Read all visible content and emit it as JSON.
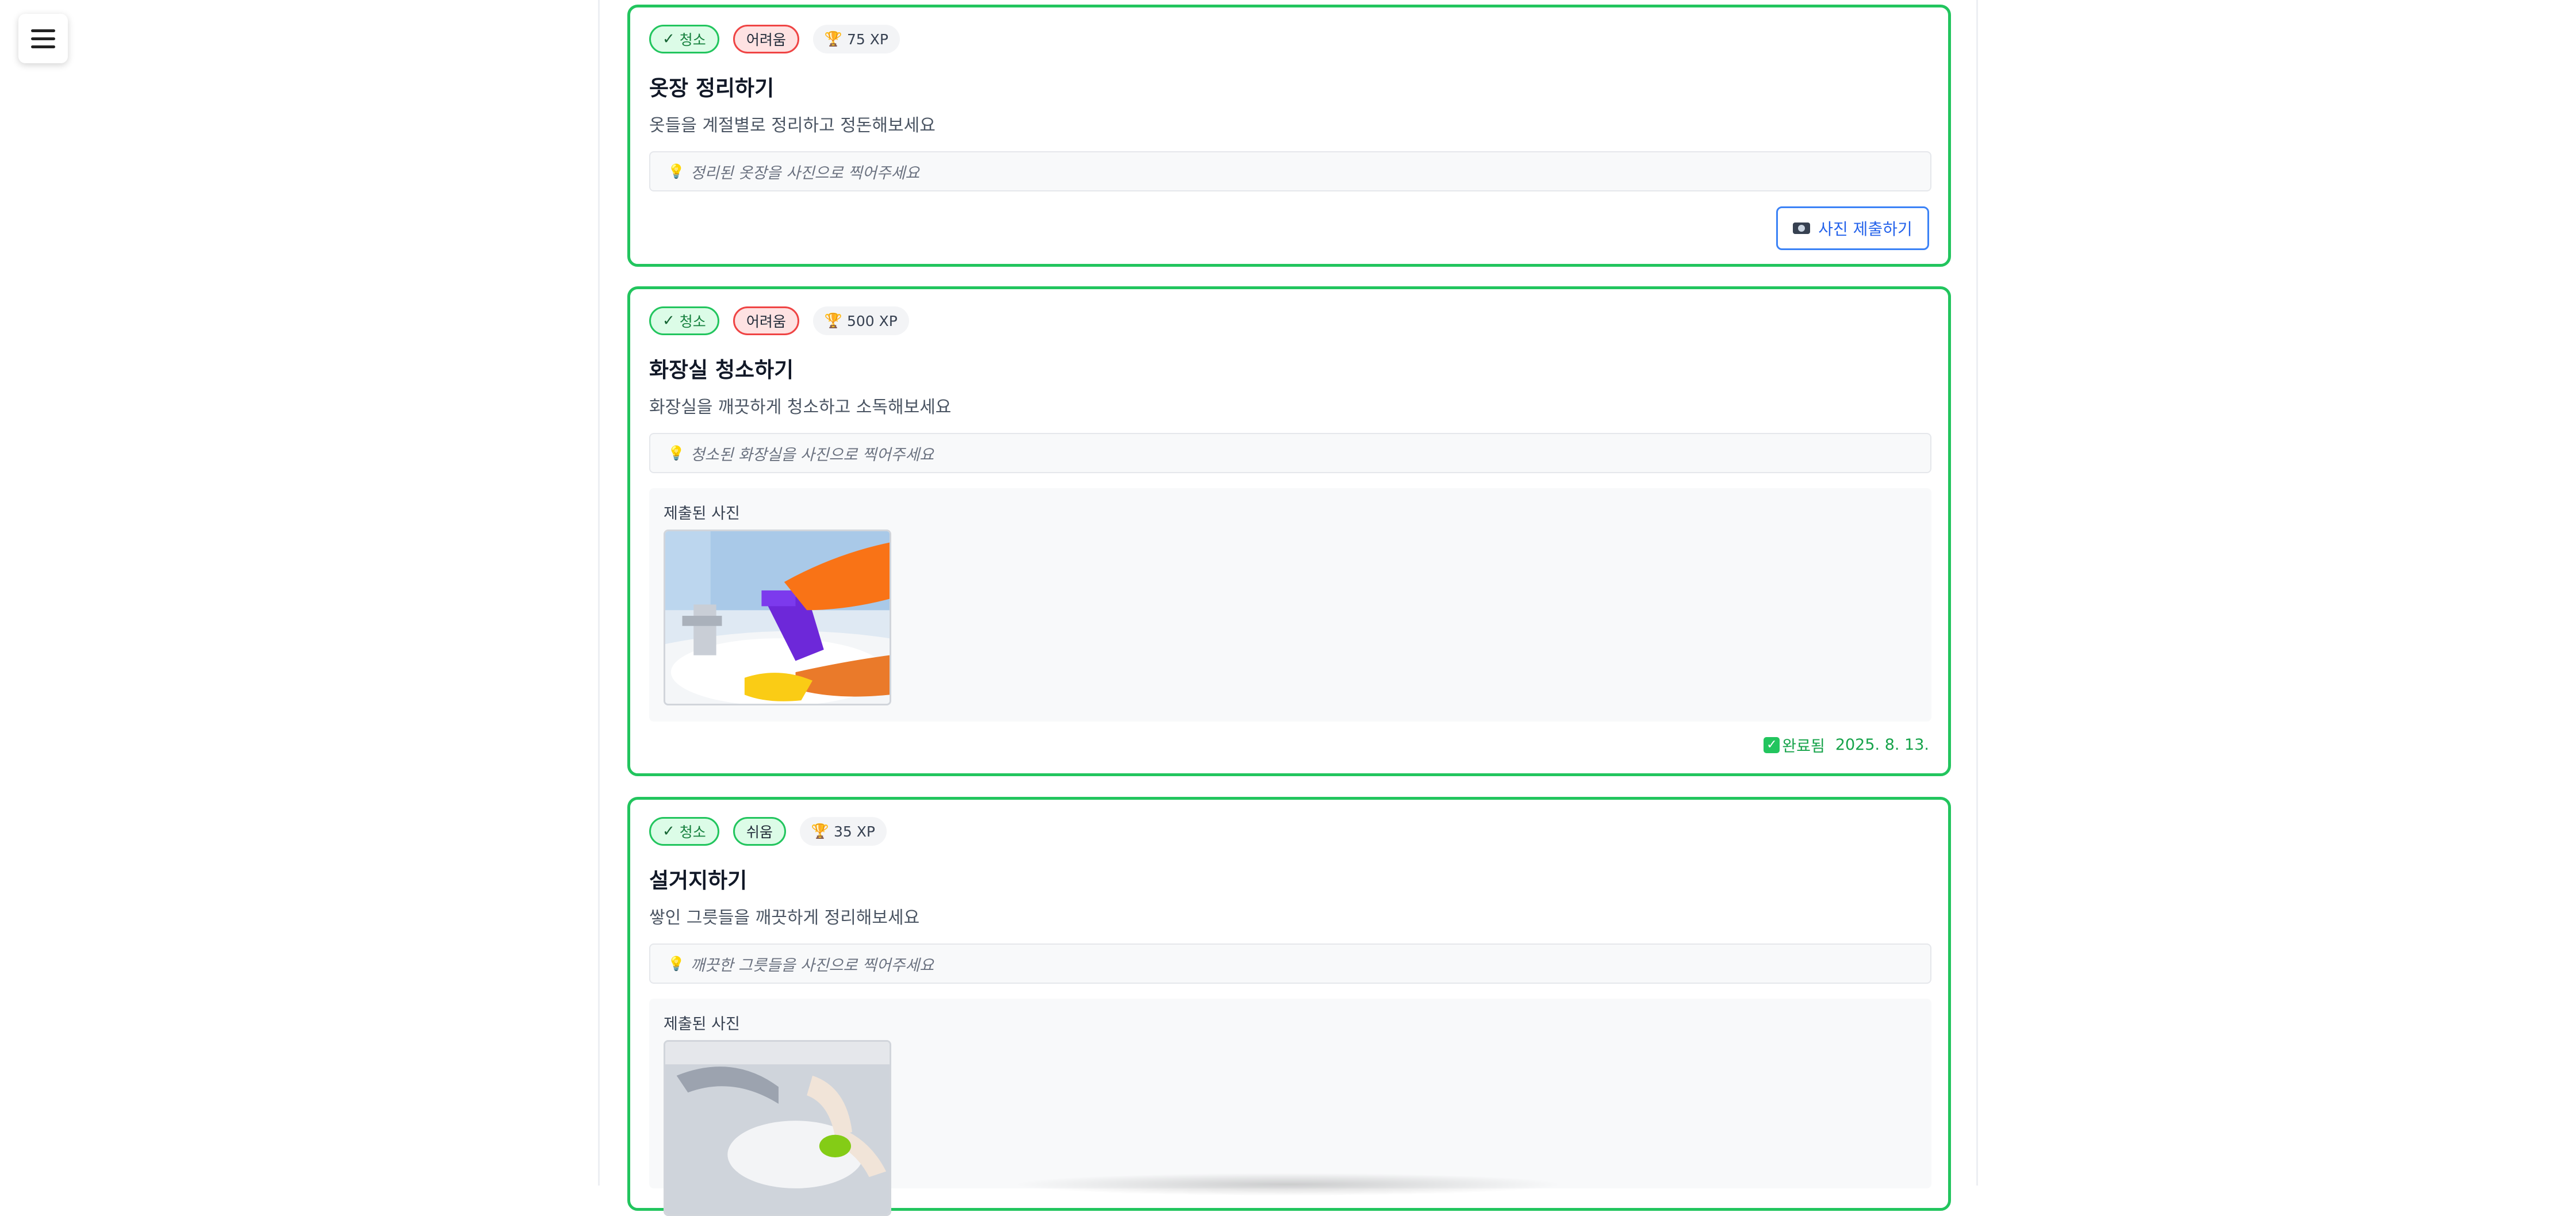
{
  "nav": {
    "menu_icon": "hamburger-menu-icon"
  },
  "missions": [
    {
      "category": "청소",
      "difficulty": "어려움",
      "xp": "75 XP",
      "title": "옷장 정리하기",
      "description": "옷들을 계절별로 정리하고 정돈해보세요",
      "hint": "정리된 옷장을 사진으로 찍어주세요",
      "submit_label": "사진 제출하기"
    },
    {
      "category": "청소",
      "difficulty": "어려움",
      "xp": "500 XP",
      "title": "화장실 청소하기",
      "description": "화장실을 깨끗하게 청소하고 소독해보세요",
      "hint": "청소된 화장실을 사진으로 찍어주세요",
      "submitted_photo_label": "제출된 사진",
      "status": "완료됨",
      "completed_date": "2025. 8. 13."
    },
    {
      "category": "청소",
      "difficulty": "쉬움",
      "xp": "35 XP",
      "title": "설거지하기",
      "description": "쌓인 그릇들을 깨끗하게 정리해보세요",
      "hint": "깨끗한 그릇들을 사진으로 찍어주세요",
      "submitted_photo_label": "제출된 사진"
    }
  ],
  "colors": {
    "card_border": "#22c55e",
    "hard_badge": "#ef4444",
    "submit_button": "#3b82f6",
    "completed_text": "#16a34a"
  }
}
